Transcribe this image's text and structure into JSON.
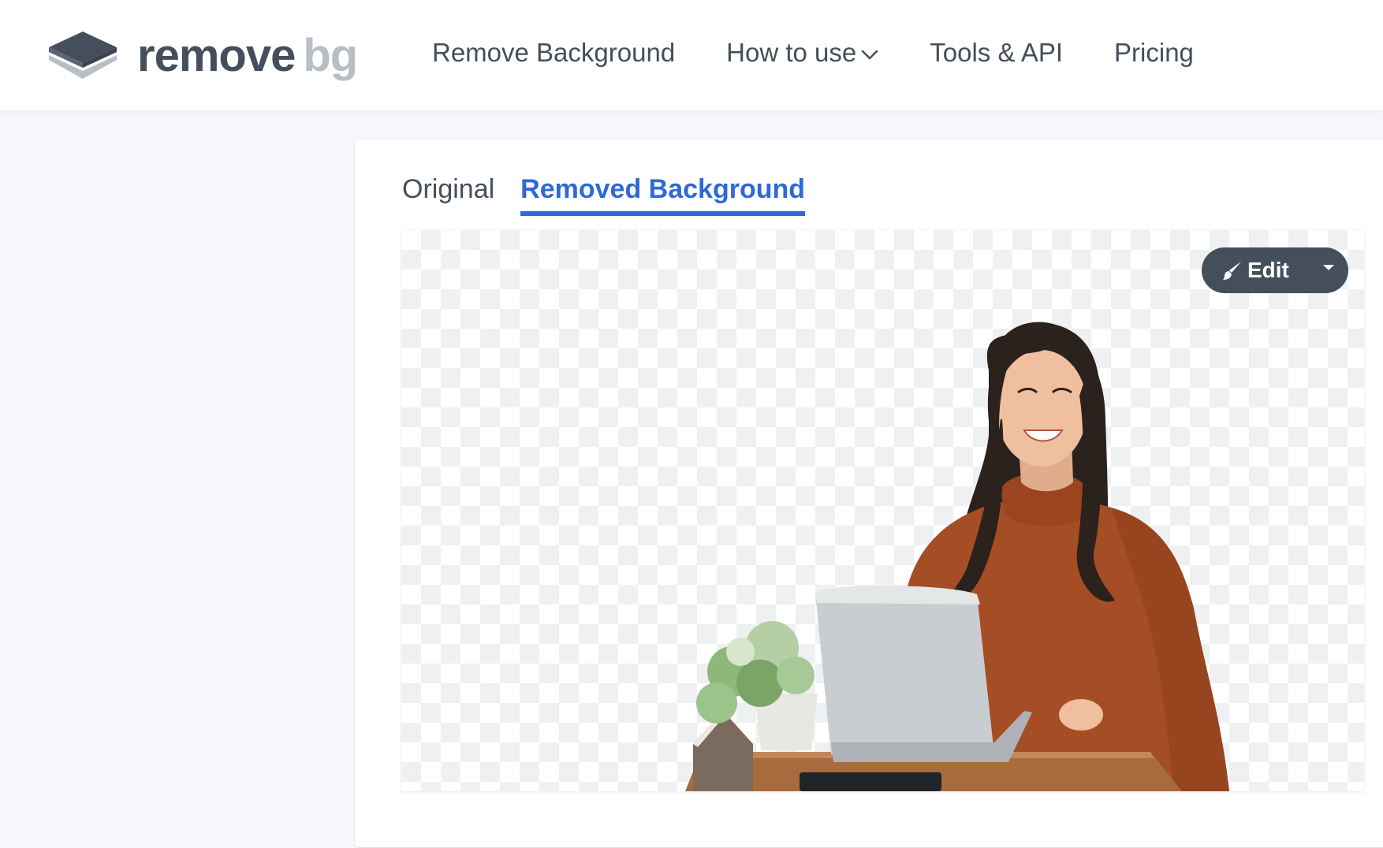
{
  "header": {
    "logo": {
      "word_main": "remove",
      "word_accent": "bg",
      "icon": "layers-icon"
    },
    "nav": {
      "remove_background": "Remove Background",
      "how_to_use": "How to use",
      "how_to_use_icon": "chevron-down-icon",
      "tools_api": "Tools & API",
      "pricing": "Pricing"
    }
  },
  "result": {
    "tabs": [
      {
        "label": "Original",
        "active": false
      },
      {
        "label": "Removed Background",
        "active": true
      }
    ],
    "edit_button": {
      "label": "Edit",
      "icon": "brush-icon",
      "dropdown_icon": "caret-down-icon"
    },
    "preview": {
      "background": "transparent-checkerboard",
      "subject": "smiling woman in orange sweater at laptop with potted plant"
    }
  },
  "colors": {
    "text": "#454f5b",
    "accent": "#2f68d8",
    "logo_accent": "#b7bec6",
    "page_bg": "#f5f7fa"
  }
}
